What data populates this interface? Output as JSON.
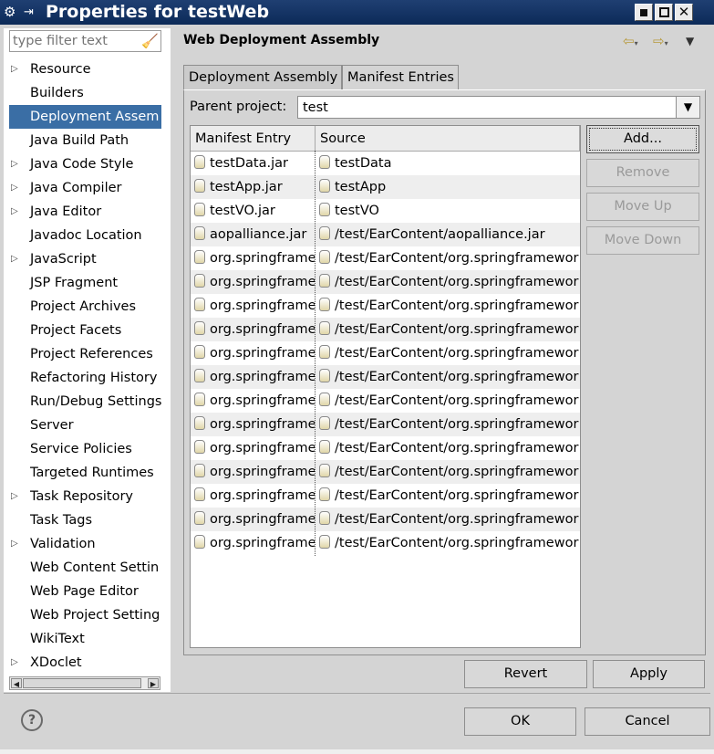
{
  "window": {
    "title": "Properties for testWeb"
  },
  "filter": {
    "placeholder": "type filter text"
  },
  "tree": {
    "items": [
      {
        "label": "Resource",
        "expandable": true,
        "selected": false
      },
      {
        "label": "Builders",
        "expandable": false,
        "selected": false
      },
      {
        "label": "Deployment Assem",
        "expandable": false,
        "selected": true
      },
      {
        "label": "Java Build Path",
        "expandable": false,
        "selected": false
      },
      {
        "label": "Java Code Style",
        "expandable": true,
        "selected": false
      },
      {
        "label": "Java Compiler",
        "expandable": true,
        "selected": false
      },
      {
        "label": "Java Editor",
        "expandable": true,
        "selected": false
      },
      {
        "label": "Javadoc Location",
        "expandable": false,
        "selected": false
      },
      {
        "label": "JavaScript",
        "expandable": true,
        "selected": false
      },
      {
        "label": "JSP Fragment",
        "expandable": false,
        "selected": false
      },
      {
        "label": "Project Archives",
        "expandable": false,
        "selected": false
      },
      {
        "label": "Project Facets",
        "expandable": false,
        "selected": false
      },
      {
        "label": "Project References",
        "expandable": false,
        "selected": false
      },
      {
        "label": "Refactoring History",
        "expandable": false,
        "selected": false
      },
      {
        "label": "Run/Debug Settings",
        "expandable": false,
        "selected": false
      },
      {
        "label": "Server",
        "expandable": false,
        "selected": false
      },
      {
        "label": "Service Policies",
        "expandable": false,
        "selected": false
      },
      {
        "label": "Targeted Runtimes",
        "expandable": false,
        "selected": false
      },
      {
        "label": "Task Repository",
        "expandable": true,
        "selected": false
      },
      {
        "label": "Task Tags",
        "expandable": false,
        "selected": false
      },
      {
        "label": "Validation",
        "expandable": true,
        "selected": false
      },
      {
        "label": "Web Content Settin",
        "expandable": false,
        "selected": false
      },
      {
        "label": "Web Page Editor",
        "expandable": false,
        "selected": false
      },
      {
        "label": "Web Project Setting",
        "expandable": false,
        "selected": false
      },
      {
        "label": "WikiText",
        "expandable": false,
        "selected": false
      },
      {
        "label": "XDoclet",
        "expandable": true,
        "selected": false
      }
    ]
  },
  "page": {
    "title": "Web Deployment Assembly"
  },
  "tabs": [
    {
      "label": "Deployment Assembly",
      "active": false
    },
    {
      "label": "Manifest Entries",
      "active": true
    }
  ],
  "parent_project": {
    "label": "Parent project:",
    "value": "test"
  },
  "table": {
    "columns": [
      "Manifest Entry",
      "Source"
    ],
    "rows": [
      [
        "testData.jar",
        "testData"
      ],
      [
        "testApp.jar",
        "testApp"
      ],
      [
        "testVO.jar",
        "testVO"
      ],
      [
        "aopalliance.jar",
        "/test/EarContent/aopalliance.jar"
      ],
      [
        "org.springframe",
        "/test/EarContent/org.springframewor"
      ],
      [
        "org.springframe",
        "/test/EarContent/org.springframewor"
      ],
      [
        "org.springframe",
        "/test/EarContent/org.springframewor"
      ],
      [
        "org.springframe",
        "/test/EarContent/org.springframewor"
      ],
      [
        "org.springframe",
        "/test/EarContent/org.springframewor"
      ],
      [
        "org.springframe",
        "/test/EarContent/org.springframewor"
      ],
      [
        "org.springframe",
        "/test/EarContent/org.springframewor"
      ],
      [
        "org.springframe",
        "/test/EarContent/org.springframewor"
      ],
      [
        "org.springframe",
        "/test/EarContent/org.springframewor"
      ],
      [
        "org.springframe",
        "/test/EarContent/org.springframewor"
      ],
      [
        "org.springframe",
        "/test/EarContent/org.springframewor"
      ],
      [
        "org.springframe",
        "/test/EarContent/org.springframewor"
      ],
      [
        "org.springframe",
        "/test/EarContent/org.springframewor"
      ]
    ]
  },
  "side_buttons": {
    "add": "Add...",
    "remove": "Remove",
    "move_up": "Move Up",
    "move_down": "Move Down"
  },
  "page_buttons": {
    "revert": "Revert",
    "apply": "Apply"
  },
  "dialog_buttons": {
    "ok": "OK",
    "cancel": "Cancel"
  },
  "colors": {
    "titlebar": "#0c2a58",
    "selection": "#3a6ea5",
    "background": "#d4d4d4"
  }
}
